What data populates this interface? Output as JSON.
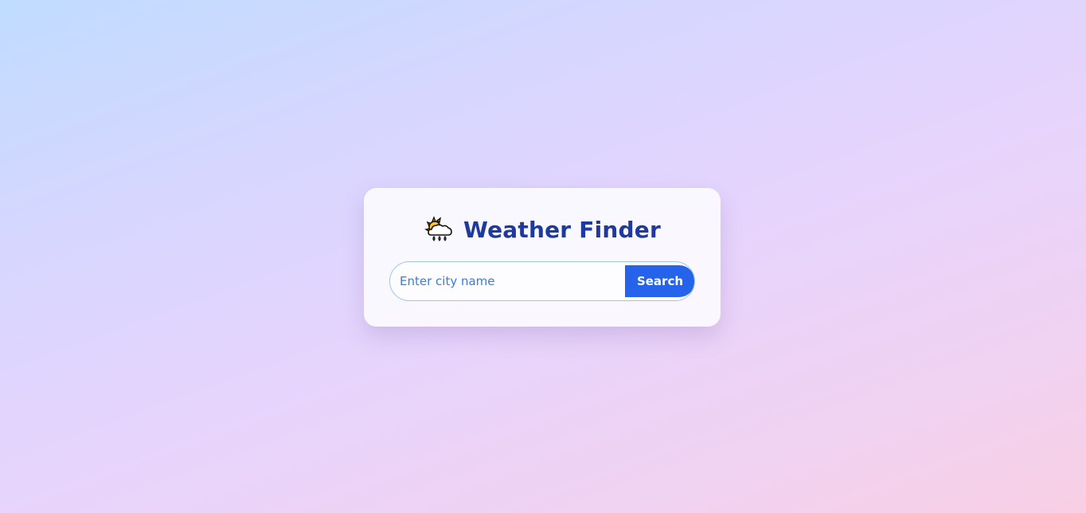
{
  "card": {
    "title_icon": "sun-behind-rain-cloud-icon",
    "title": "Weather Finder"
  },
  "search": {
    "placeholder": "Enter city name",
    "value": "",
    "button_label": "Search"
  },
  "colors": {
    "title": "#1e3a9e",
    "button": "#2563eb",
    "input_border": "#9cc4ef",
    "placeholder": "#3b7dd8"
  }
}
